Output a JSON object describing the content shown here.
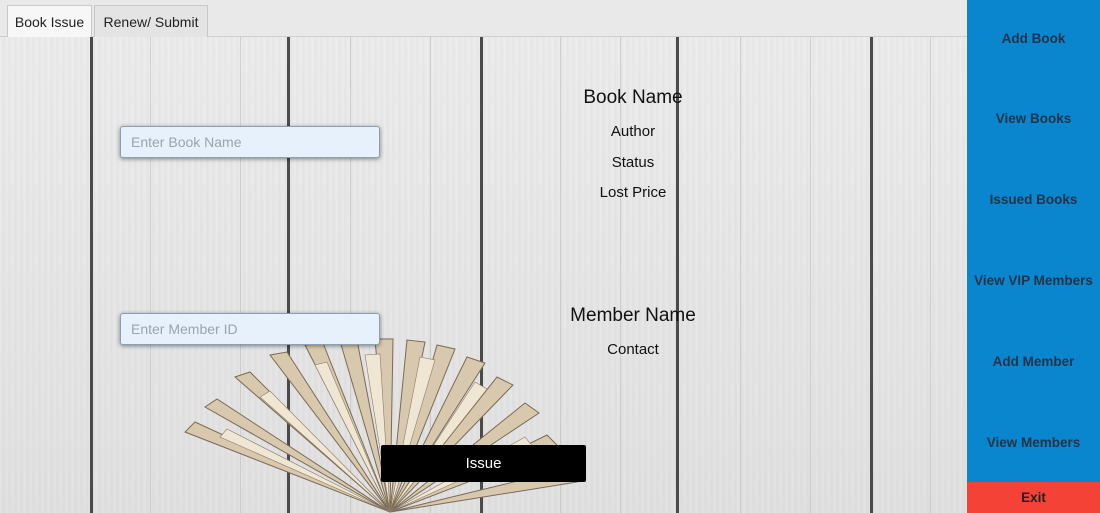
{
  "tabs": [
    {
      "label": "Book Issue",
      "active": true
    },
    {
      "label": "Renew/ Submit",
      "active": false
    }
  ],
  "issue_form": {
    "book_name_placeholder": "Enter Book Name",
    "member_id_placeholder": "Enter Member ID",
    "book_info": {
      "name": "Book Name",
      "author": "Author",
      "status": "Status",
      "lost_price": "Lost Price"
    },
    "member_info": {
      "name": "Member Name",
      "contact": "Contact"
    },
    "issue_button": "Issue"
  },
  "sidebar": {
    "items": [
      {
        "label": "Add Book"
      },
      {
        "label": "View Books"
      },
      {
        "label": "Issued Books"
      },
      {
        "label": "View VIP Members"
      },
      {
        "label": "Add Member"
      },
      {
        "label": "View Members"
      }
    ],
    "exit_label": "Exit"
  },
  "colors": {
    "sidebar_bg": "#0a86cf",
    "exit_bg": "#f44336",
    "issue_button_bg": "#000000",
    "input_bg": "#e6f1fb"
  }
}
